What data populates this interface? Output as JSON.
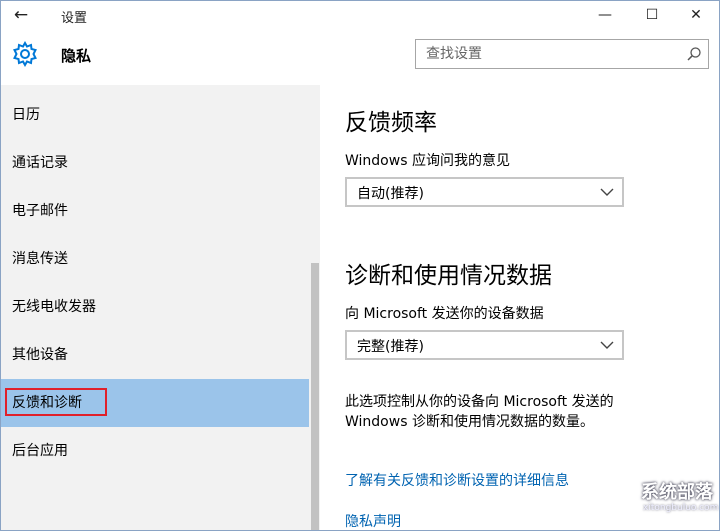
{
  "window": {
    "title": "设置",
    "back_glyph": "←",
    "min_glyph": "—",
    "max_glyph": "☐",
    "close_glyph": "✕"
  },
  "header": {
    "title": "隐私",
    "search_placeholder": "查找设置",
    "gear_icon": "gear-icon",
    "search_icon": "search-icon"
  },
  "sidebar": {
    "items": [
      {
        "label": "日历"
      },
      {
        "label": "通话记录"
      },
      {
        "label": "电子邮件"
      },
      {
        "label": "消息传送"
      },
      {
        "label": "无线电收发器"
      },
      {
        "label": "其他设备"
      },
      {
        "label": "反馈和诊断"
      },
      {
        "label": "后台应用"
      }
    ],
    "selected_index": 6
  },
  "content": {
    "feedback_heading": "反馈频率",
    "feedback_label": "Windows 应询问我的意见",
    "feedback_value": "自动(推荐)",
    "diag_heading": "诊断和使用情况数据",
    "diag_label": "向 Microsoft 发送你的设备数据",
    "diag_value": "完整(推荐)",
    "description": "此选项控制从你的设备向 Microsoft 发送的 Windows 诊断和使用情况数据的数量。",
    "link_learn_more": "了解有关反馈和诊断设置的详细信息",
    "link_privacy": "隐私声明"
  },
  "watermark": {
    "text": "系统部落",
    "sub": "xitongbuluo.com"
  },
  "colors": {
    "accent_selected": "#9bc4ea",
    "link": "#0063b1",
    "gear": "#0078d7",
    "highlight_box": "#e0202a"
  }
}
